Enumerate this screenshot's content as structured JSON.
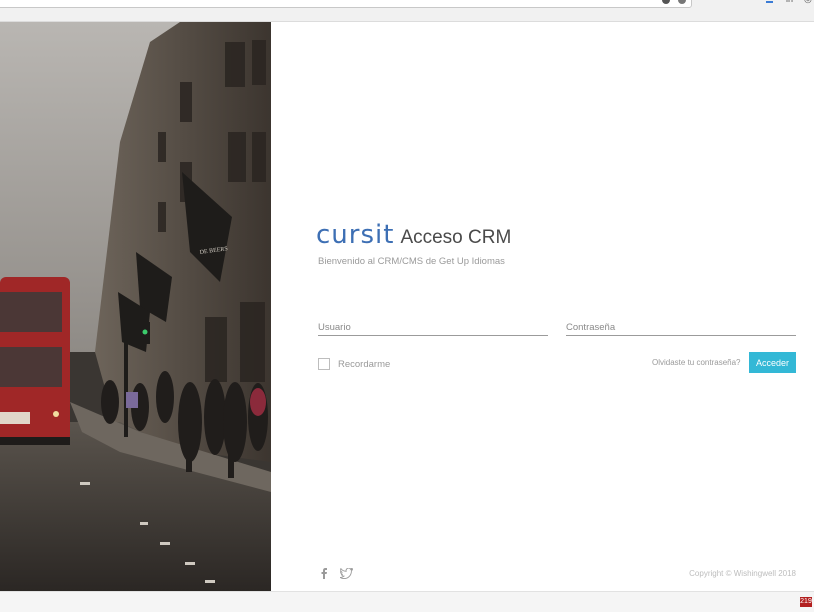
{
  "login": {
    "logo_text": "cursit",
    "title": "Acceso CRM",
    "welcome": "Bienvenido al CRM/CMS de Get Up Idiomas",
    "username_placeholder": "Usuario",
    "password_placeholder": "Contraseña",
    "remember_label": "Recordarme",
    "forgot_label": "Olvidaste tu contraseña?",
    "submit_label": "Acceder"
  },
  "footer": {
    "copyright": "Copyright © Wishingwell 2018",
    "social_icons": [
      "facebook-icon",
      "twitter-icon"
    ]
  },
  "photo": {
    "store_sign": "DE BEERS"
  },
  "badge": {
    "text": "219"
  },
  "colors": {
    "logo_blue": "#3d6fb4",
    "button_cyan": "#33b8d6",
    "badge_red": "#b21f1f"
  }
}
